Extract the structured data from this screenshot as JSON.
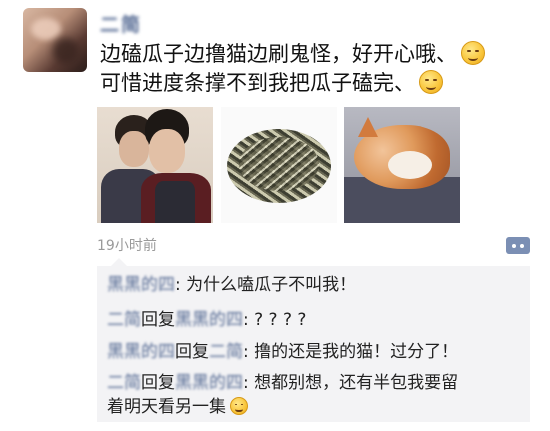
{
  "post": {
    "username": "二简",
    "text_line1": "边磕瓜子边撸猫边刷鬼怪，好开心哦、",
    "text_line2": "可惜进度条撑不到我把瓜子磕完、",
    "timestamp": "19小时前"
  },
  "photos": [
    {
      "icon": "photo-two-men"
    },
    {
      "icon": "photo-sunflower-seeds"
    },
    {
      "icon": "photo-sleeping-cat"
    }
  ],
  "comments": [
    {
      "author": "黑黑的四",
      "reply_word": "",
      "target": "",
      "text": ": 为什么嗑瓜子不叫我！"
    },
    {
      "author": "二简",
      "reply_word": "回复",
      "target": "黑黑的四",
      "text": ": ? ? ? ?"
    },
    {
      "author": "黑黑的四",
      "reply_word": "回复",
      "target": "二简",
      "text": ": 撸的还是我的猫！过分了！"
    },
    {
      "author": "二简",
      "reply_word": "回复",
      "target": "黑黑的四",
      "text": ": 想都别想，还有半包我要留",
      "text_cont": "着明天看另一集"
    }
  ],
  "colors": {
    "name": "#566b94",
    "comment_bg": "#f3f3f5",
    "timestamp": "#9a9a9a",
    "more_button": "#7b8fb4"
  }
}
